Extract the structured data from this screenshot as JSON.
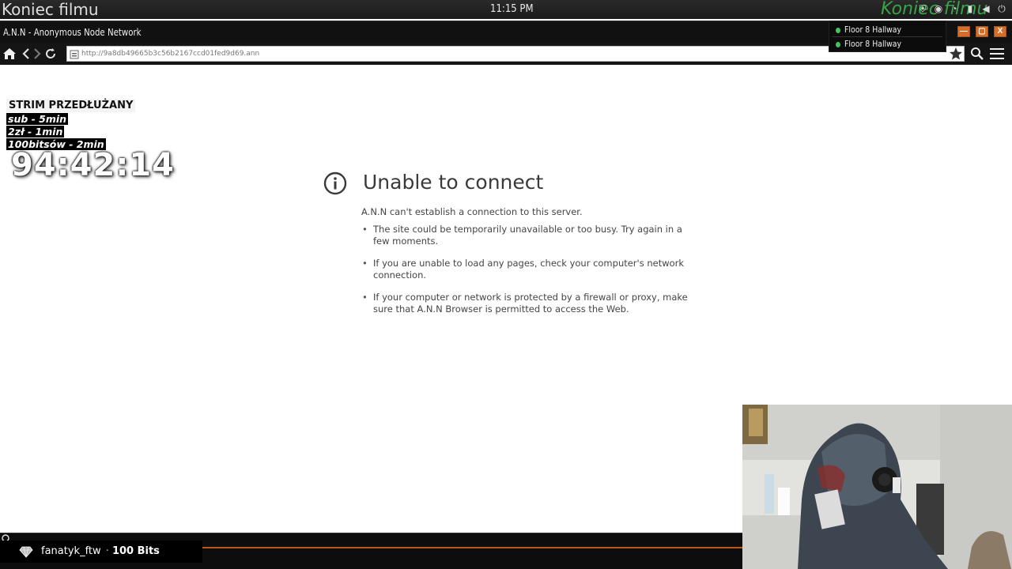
{
  "system_bar": {
    "overlay_left": "Koniec filmu",
    "clock": "11:15 PM",
    "overlay_right": "Koniec filmu"
  },
  "window": {
    "title": "A.N.N - Anonymous Node Network",
    "buttons": {
      "minimize": "—",
      "maximize": "▢",
      "close": "X"
    }
  },
  "dropdown": {
    "items": [
      {
        "label": "Floor 8 Hallway",
        "status_color": "#46c45a"
      },
      {
        "label": "Floor 8 Hallway",
        "status_color": "#46c45a"
      }
    ]
  },
  "navbar": {
    "url": "http://9a8db49665b3c56b2167ccd01fed9d69.ann",
    "icons": [
      "home-icon",
      "back-icon",
      "forward-icon",
      "reload-icon",
      "site-identity-icon",
      "bookmark-star-icon",
      "search-icon",
      "menu-icon"
    ]
  },
  "stream_overlay": {
    "heading": "STRIM PRZEDŁUŻANY",
    "rows": [
      "sub - 5min",
      "2zł - 1min",
      "100bitsów - 2min"
    ],
    "timer": "94:42:14"
  },
  "error_page": {
    "title": "Unable to connect",
    "description": "A.N.N can't establish a connection to this server.",
    "bullets": [
      "The site could be temporarily unavailable or too busy. Try again in a few moments.",
      "If you are unable to load any pages, check your computer's network connection.",
      "If your computer or network is protected by a firewall or proxy, make sure that A.N.N Browser is permitted to access the Web."
    ]
  },
  "alert": {
    "username": "fanatyk_ftw",
    "separator": "·",
    "amount": "100 Bits"
  },
  "colors": {
    "accent_orange": "#d66e2a",
    "status_green": "#46c45a",
    "bottom_line": "#b85a18"
  }
}
